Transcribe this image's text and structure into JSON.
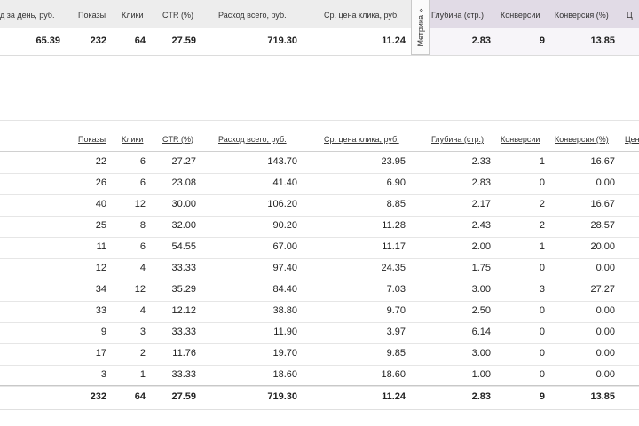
{
  "summary": {
    "headers": [
      "д за день, руб.",
      "Показы",
      "Клики",
      "CTR (%)",
      "Расход всего, руб.",
      "Ср. цена клика, руб.",
      "Глубина (стр.)",
      "Конверсии",
      "Конверсия (%)",
      "Ц"
    ],
    "metrika_tab": "Метрика »",
    "values": [
      "65.39",
      "232",
      "64",
      "27.59",
      "719.30",
      "11.24",
      "2.83",
      "9",
      "13.85"
    ]
  },
  "detail": {
    "headers": [
      "Показы",
      "Клики",
      "CTR (%)",
      "Расход всего, руб.",
      "Ср. цена клика, руб.",
      "Глубина (стр.)",
      "Конверсии",
      "Конверсия (%)",
      "Цен"
    ],
    "rows": [
      [
        "22",
        "6",
        "27.27",
        "143.70",
        "23.95",
        "2.33",
        "1",
        "16.67"
      ],
      [
        "26",
        "6",
        "23.08",
        "41.40",
        "6.90",
        "2.83",
        "0",
        "0.00"
      ],
      [
        "40",
        "12",
        "30.00",
        "106.20",
        "8.85",
        "2.17",
        "2",
        "16.67"
      ],
      [
        "25",
        "8",
        "32.00",
        "90.20",
        "11.28",
        "2.43",
        "2",
        "28.57"
      ],
      [
        "11",
        "6",
        "54.55",
        "67.00",
        "11.17",
        "2.00",
        "1",
        "20.00"
      ],
      [
        "12",
        "4",
        "33.33",
        "97.40",
        "24.35",
        "1.75",
        "0",
        "0.00"
      ],
      [
        "34",
        "12",
        "35.29",
        "84.40",
        "7.03",
        "3.00",
        "3",
        "27.27"
      ],
      [
        "33",
        "4",
        "12.12",
        "38.80",
        "9.70",
        "2.50",
        "0",
        "0.00"
      ],
      [
        "9",
        "3",
        "33.33",
        "11.90",
        "3.97",
        "6.14",
        "0",
        "0.00"
      ],
      [
        "17",
        "2",
        "11.76",
        "19.70",
        "9.85",
        "3.00",
        "0",
        "0.00"
      ],
      [
        "3",
        "1",
        "33.33",
        "18.60",
        "18.60",
        "1.00",
        "0",
        "0.00"
      ]
    ],
    "total": [
      "232",
      "64",
      "27.59",
      "719.30",
      "11.24",
      "2.83",
      "9",
      "13.85"
    ]
  }
}
